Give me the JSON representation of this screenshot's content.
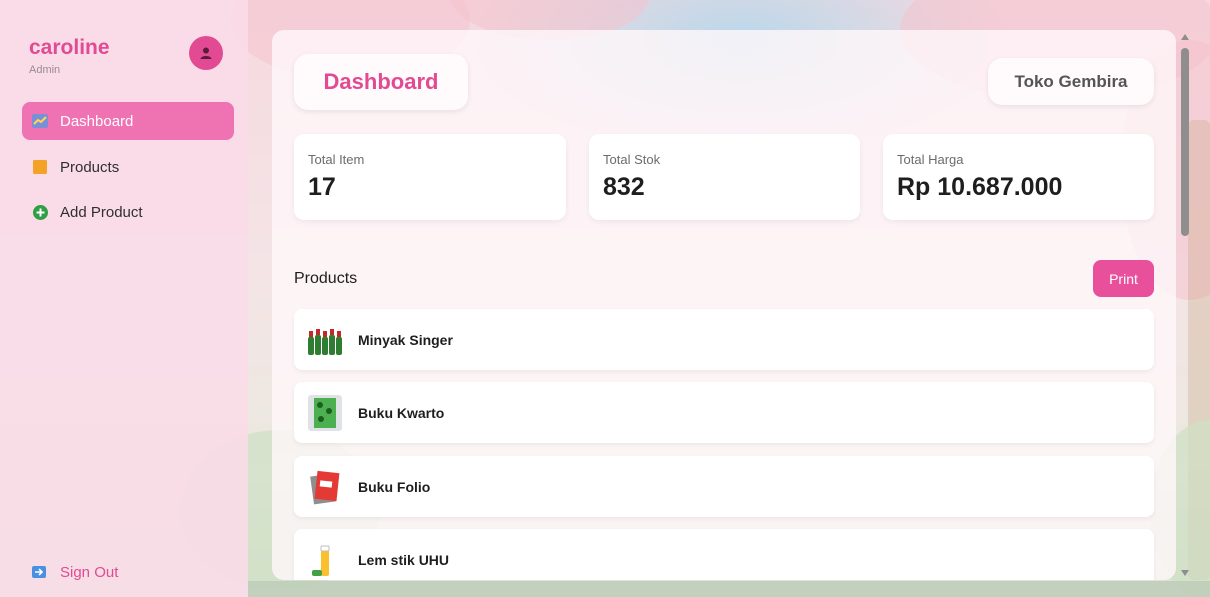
{
  "user": {
    "name": "caroline",
    "role": "Admin"
  },
  "sidebar": {
    "items": [
      {
        "label": "Dashboard",
        "icon": "chart-icon",
        "active": true
      },
      {
        "label": "Products",
        "icon": "box-icon",
        "active": false
      },
      {
        "label": "Add Product",
        "icon": "plus-circle-icon",
        "active": false
      }
    ],
    "signout_label": "Sign Out"
  },
  "header": {
    "title": "Dashboard",
    "store_name": "Toko Gembira"
  },
  "stats": [
    {
      "label": "Total Item",
      "value": "17"
    },
    {
      "label": "Total Stok",
      "value": "832"
    },
    {
      "label": "Total Harga",
      "value": "Rp 10.687.000"
    }
  ],
  "products_section": {
    "heading": "Products",
    "print_label": "Print",
    "items": [
      {
        "name": "Minyak Singer"
      },
      {
        "name": "Buku Kwarto"
      },
      {
        "name": "Buku Folio"
      },
      {
        "name": "Lem stik UHU"
      }
    ]
  },
  "colors": {
    "accent": "#e24a93",
    "active_nav": "#ef73b3",
    "print_button": "#e8509b"
  }
}
